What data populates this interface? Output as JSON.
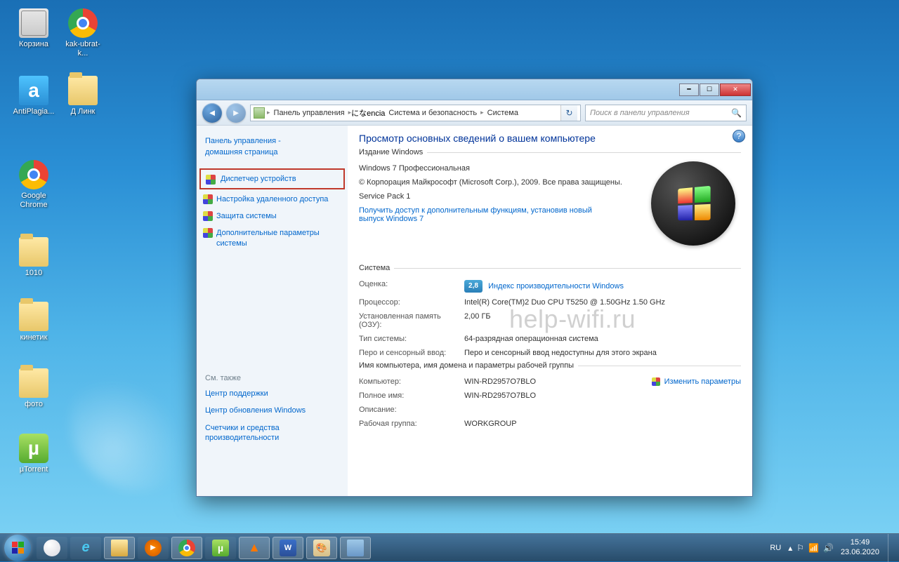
{
  "desktop_icons": [
    {
      "name": "recycle-bin",
      "label": "Корзина"
    },
    {
      "name": "chrome-shortcut",
      "label": "kak-ubrat-k..."
    },
    {
      "name": "antiplagiat",
      "label": "AntiPlagia..."
    },
    {
      "name": "folder-dlink",
      "label": "Д Линк"
    },
    {
      "name": "google-chrome",
      "label": "Google Chrome"
    },
    {
      "name": "folder-1010",
      "label": "1010"
    },
    {
      "name": "folder-kinetik",
      "label": "кинетик"
    },
    {
      "name": "folder-photo",
      "label": "фото"
    },
    {
      "name": "utorrent",
      "label": "µTorrent"
    }
  ],
  "window": {
    "title_buttons": {
      "min": "━",
      "max": "☐",
      "close": "✕"
    },
    "breadcrumb": [
      "Панель управления",
      "Система и безопасность",
      "Система"
    ],
    "search_placeholder": "Поиск в панели управления",
    "sidebar": {
      "home1": "Панель управления -",
      "home2": "домашняя страница",
      "links": [
        "Диспетчер устройств",
        "Настройка удаленного доступа",
        "Защита системы",
        "Дополнительные параметры системы"
      ],
      "see_also_title": "См. также",
      "see_also": [
        "Центр поддержки",
        "Центр обновления Windows",
        "Счетчики и средства производительности"
      ]
    },
    "content": {
      "heading": "Просмотр основных сведений о вашем компьютере",
      "group_windows": "Издание Windows",
      "edition": "Windows 7 Профессиональная",
      "copyright": "© Корпорация Майкрософт (Microsoft Corp.), 2009. Все права защищены.",
      "sp": "Service Pack 1",
      "upgrade_link": "Получить доступ к дополнительным функциям, установив новый выпуск Windows 7",
      "group_system": "Система",
      "rating_label": "Оценка:",
      "rating_value": "2,8",
      "rating_link": "Индекс производительности Windows",
      "cpu_label": "Процессор:",
      "cpu_value": "Intel(R) Core(TM)2 Duo CPU    T5250  @ 1.50GHz  1.50 GHz",
      "ram_label": "Установленная память (ОЗУ):",
      "ram_value": "2,00 ГБ",
      "type_label": "Тип системы:",
      "type_value": "64-разрядная операционная система",
      "pen_label": "Перо и сенсорный ввод:",
      "pen_value": "Перо и сенсорный ввод недоступны для этого экрана",
      "group_name": "Имя компьютера, имя домена и параметры рабочей группы",
      "comp_label": "Компьютер:",
      "comp_value": "WIN-RD2957O7BLO",
      "change_link": "Изменить параметры",
      "full_label": "Полное имя:",
      "full_value": "WIN-RD2957O7BLO",
      "desc_label": "Описание:",
      "desc_value": "",
      "wg_label": "Рабочая группа:",
      "wg_value": "WORKGROUP"
    },
    "watermark": "help-wifi.ru"
  },
  "taskbar": {
    "lang": "RU",
    "time": "15:49",
    "date": "23.06.2020"
  }
}
